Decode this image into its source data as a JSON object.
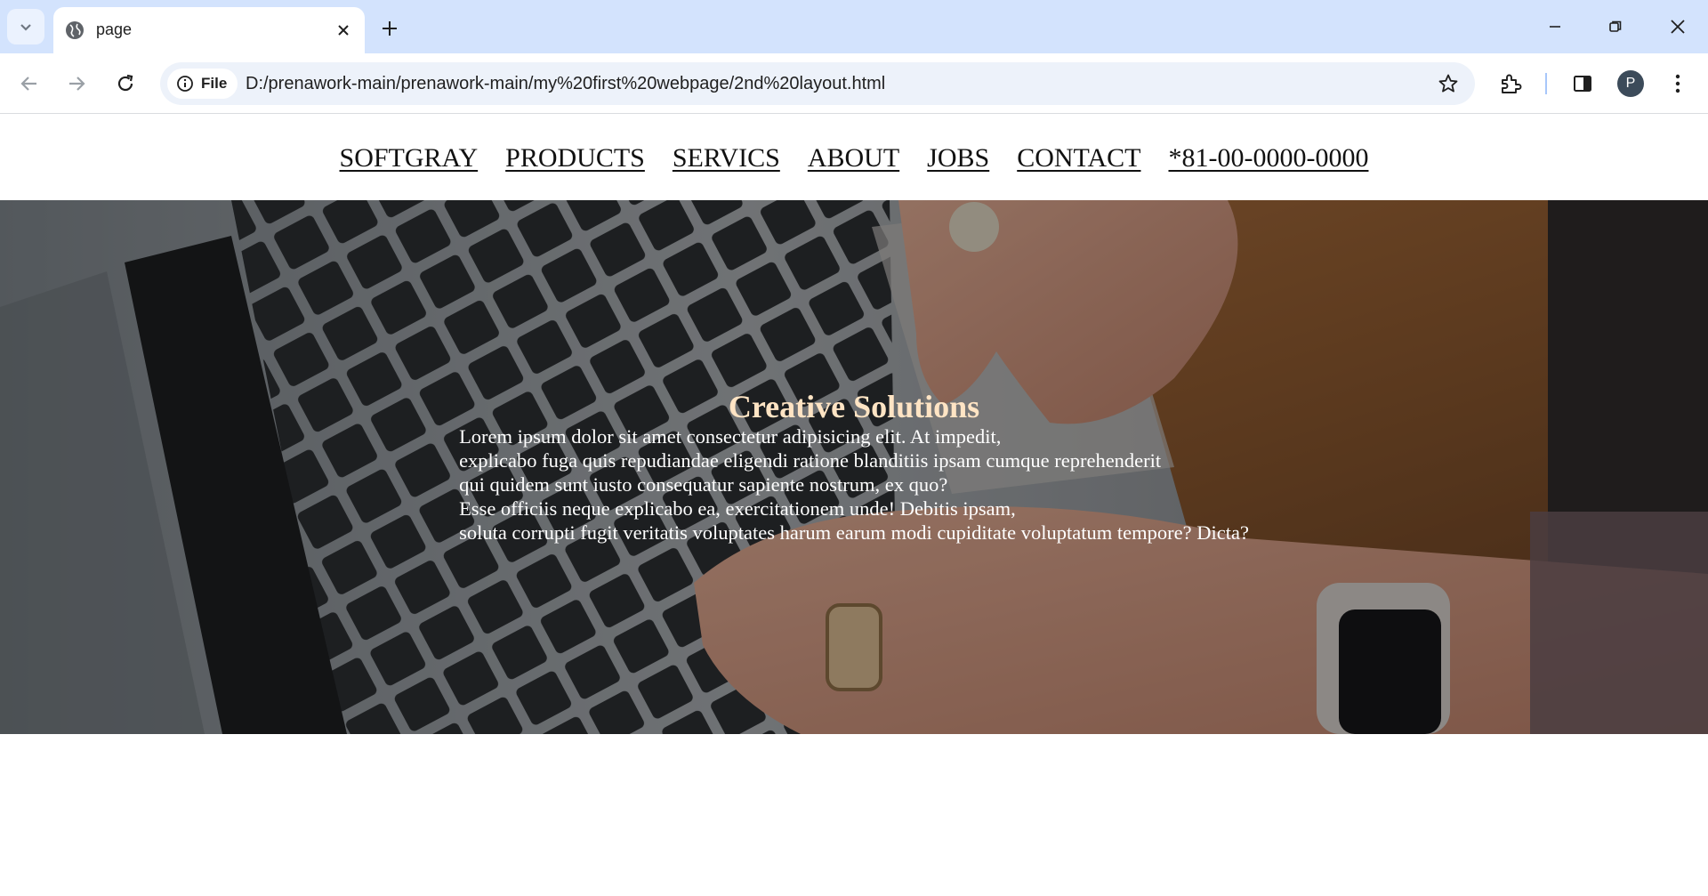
{
  "browser": {
    "tab_title": "page",
    "site_chip_label": "File",
    "url": "D:/prenawork-main/prenawork-main/my%20first%20webpage/2nd%20layout.html",
    "profile_initial": "P",
    "icons": [
      "tab-search-icon",
      "globe-icon",
      "close-icon",
      "plus-icon",
      "minimize-icon",
      "restore-icon",
      "window-close-icon",
      "back-icon",
      "forward-icon",
      "reload-icon",
      "info-icon",
      "star-icon",
      "extensions-icon",
      "side-panel-icon",
      "menu-icon"
    ]
  },
  "nav": {
    "items": [
      {
        "label": "SOFTGRAY"
      },
      {
        "label": "PRODUCTS"
      },
      {
        "label": "SERVICS"
      },
      {
        "label": "ABOUT"
      },
      {
        "label": "JOBS"
      },
      {
        "label": "CONTACT"
      },
      {
        "label": "*81-00-0000-0000"
      }
    ]
  },
  "hero": {
    "title": "Creative Solutions",
    "lines": [
      "Lorem ipsum dolor sit amet consectetur adipisicing elit. At impedit,",
      "explicabo fuga quis repudiandae eligendi ratione blanditiis ipsam cumque reprehenderit",
      "qui quidem sunt iusto consequatur sapiente nostrum, ex quo?",
      "Esse officiis neque explicabo ea, exercitationem unde! Debitis ipsam,",
      "soluta corrupti fugit veritatis voluptates harum earum modi cupiditate voluptatum tempore? Dicta?"
    ],
    "colors": {
      "title": "#ffe4c4",
      "body": "#ffffff"
    }
  }
}
